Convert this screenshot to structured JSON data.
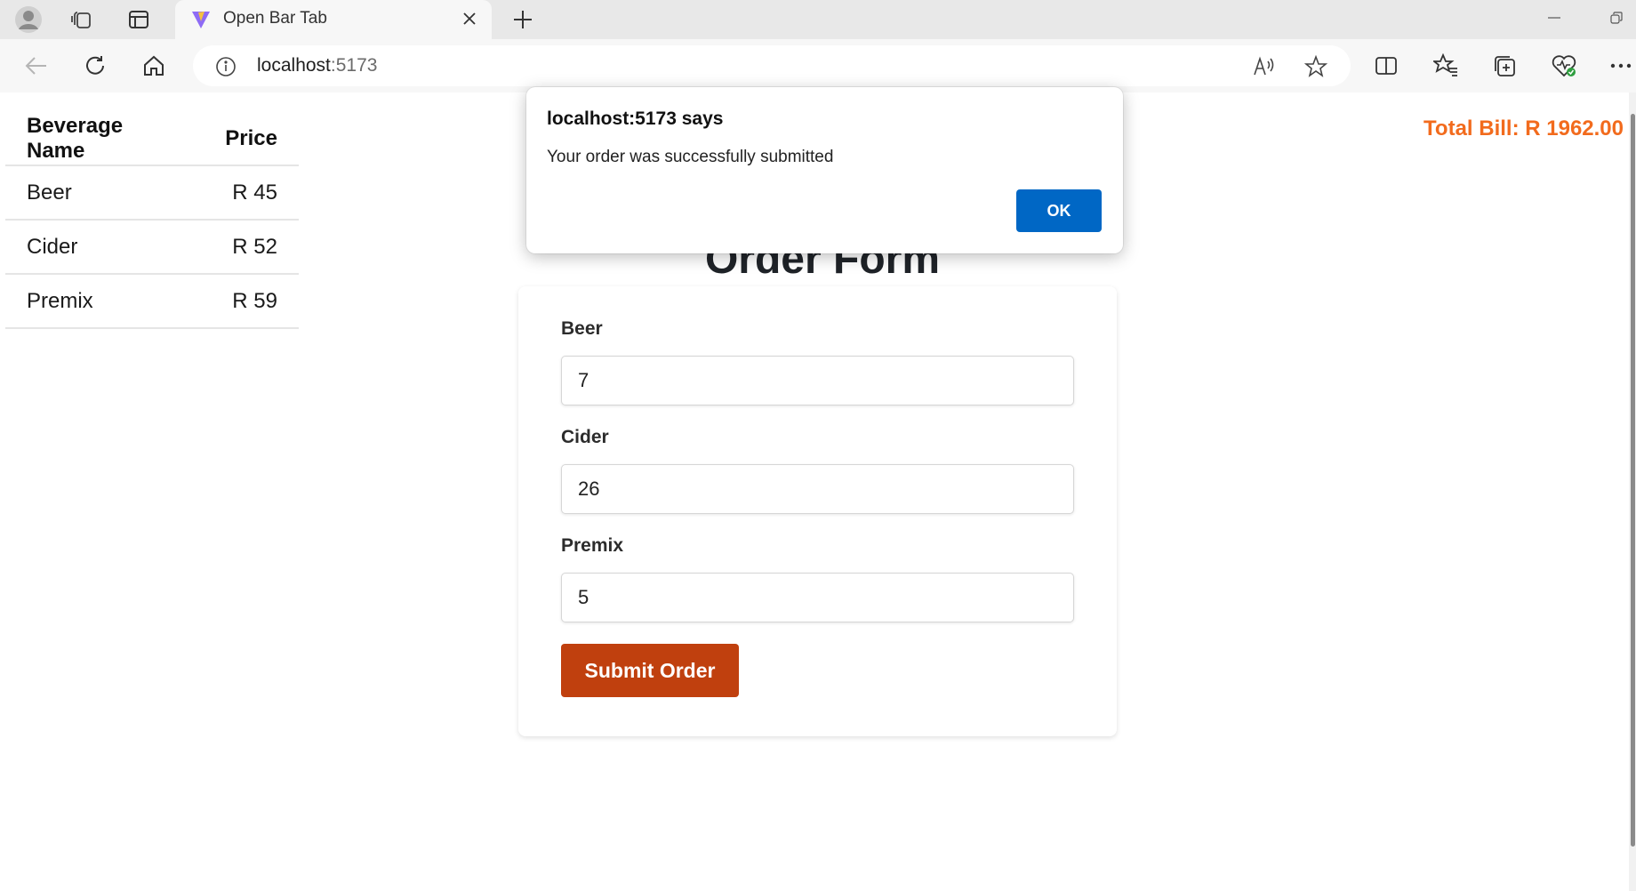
{
  "browser": {
    "tab": {
      "title": "Open Bar Tab"
    },
    "address": {
      "host": "localhost",
      "port": ":5173"
    },
    "icons": [
      "profile-icon",
      "workspaces-icon",
      "tab-actions-icon",
      "vite-favicon",
      "close-icon",
      "new-tab-icon",
      "minimize-icon",
      "restore-icon",
      "back-icon",
      "refresh-icon",
      "home-icon",
      "site-info-icon",
      "read-aloud-icon",
      "favorite-star-icon",
      "split-screen-icon",
      "favorites-icon",
      "collections-icon",
      "browser-essentials-icon",
      "more-icon"
    ]
  },
  "menu": {
    "headers": {
      "name": "Beverage Name",
      "price": "Price"
    },
    "rows": [
      {
        "name": "Beer",
        "price": "R 45"
      },
      {
        "name": "Cider",
        "price": "R 52"
      },
      {
        "name": "Premix",
        "price": "R 59"
      }
    ]
  },
  "total_bill": "Total Bill: R 1962.00",
  "order_form": {
    "heading": "Order Form",
    "fields": [
      {
        "label": "Beer",
        "value": "7"
      },
      {
        "label": "Cider",
        "value": "26"
      },
      {
        "label": "Premix",
        "value": "5"
      }
    ],
    "submit_label": "Submit Order"
  },
  "dialog": {
    "title": "localhost:5173 says",
    "message": "Your order was successfully submitted",
    "ok_label": "OK"
  },
  "colors": {
    "total_accent": "#f26b1d",
    "submit_button": "#c0400e",
    "dialog_ok": "#0067c5"
  }
}
